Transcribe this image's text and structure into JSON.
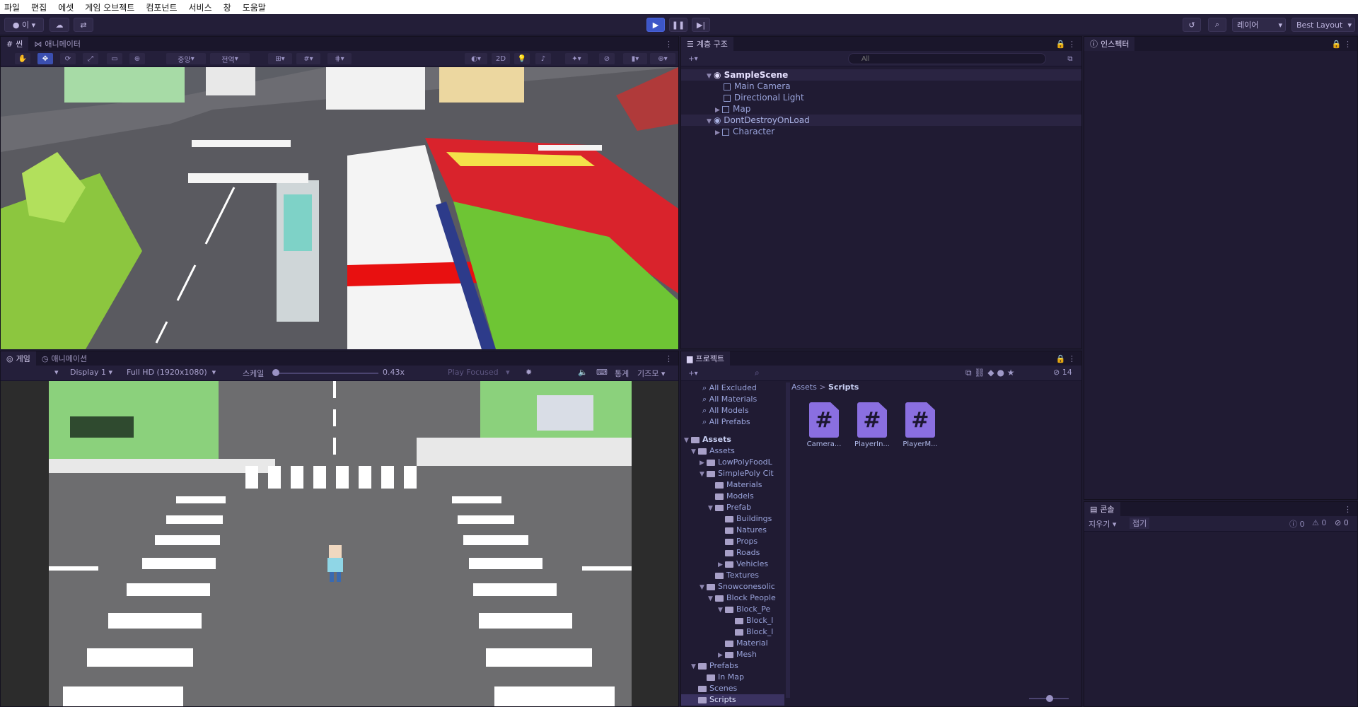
{
  "menu": [
    "파일",
    "편집",
    "에셋",
    "게임 오브젝트",
    "컴포넌트",
    "서비스",
    "창",
    "도움말"
  ],
  "toolbar": {
    "account_label": "이",
    "layers_label": "레이어",
    "layout_label": "Best Layout"
  },
  "scene_panel": {
    "tabs": [
      "씬",
      "애니메이터"
    ],
    "shading_label": "중앙",
    "global_label": "전역",
    "mode_2d": "2D"
  },
  "hierarchy": {
    "tab": "계층 구조",
    "search_placeholder": "All",
    "items": [
      {
        "label": "SampleScene",
        "type": "scene",
        "depth": 0
      },
      {
        "label": "Main Camera",
        "type": "object",
        "depth": 1
      },
      {
        "label": "Directional Light",
        "type": "object",
        "depth": 1
      },
      {
        "label": "Map",
        "type": "object",
        "depth": 1
      },
      {
        "label": "DontDestroyOnLoad",
        "type": "scene",
        "depth": 0
      },
      {
        "label": "Character",
        "type": "object",
        "depth": 1
      }
    ]
  },
  "inspector": {
    "tab": "인스펙터"
  },
  "game_panel": {
    "tabs": [
      "게임",
      "애니메이션"
    ],
    "display": "Display 1",
    "resolution": "Full HD (1920x1080)",
    "scale_label": "스케일",
    "scale_value": "0.43x",
    "play_mode": "Play Focused",
    "stats": "통계",
    "gizmos": "기즈모"
  },
  "project": {
    "tab": "프로젝트",
    "hidden_count": "14",
    "breadcrumb": [
      "Assets",
      "Scripts"
    ],
    "favorites": [
      "All Excluded",
      "All Materials",
      "All Models",
      "All Prefabs"
    ],
    "tree": [
      {
        "label": "Assets",
        "depth": 0,
        "bold": true
      },
      {
        "label": "Assets",
        "depth": 1
      },
      {
        "label": "LowPolyFoodL",
        "depth": 2
      },
      {
        "label": "SimplePoly Cit",
        "depth": 2
      },
      {
        "label": "Materials",
        "depth": 3
      },
      {
        "label": "Models",
        "depth": 3
      },
      {
        "label": "Prefab",
        "depth": 3
      },
      {
        "label": "Buildings",
        "depth": 4
      },
      {
        "label": "Natures",
        "depth": 4
      },
      {
        "label": "Props",
        "depth": 4
      },
      {
        "label": "Roads",
        "depth": 4
      },
      {
        "label": "Vehicles",
        "depth": 4
      },
      {
        "label": "Textures",
        "depth": 3
      },
      {
        "label": "Snowconesolic",
        "depth": 2
      },
      {
        "label": "Block People",
        "depth": 3
      },
      {
        "label": "Block_Pe",
        "depth": 4
      },
      {
        "label": "Block_l",
        "depth": 5
      },
      {
        "label": "Block_l",
        "depth": 5
      },
      {
        "label": "Material",
        "depth": 4
      },
      {
        "label": "Mesh",
        "depth": 4
      },
      {
        "label": "Prefabs",
        "depth": 1
      },
      {
        "label": "In Map",
        "depth": 2
      },
      {
        "label": "Scenes",
        "depth": 1
      },
      {
        "label": "Scripts",
        "depth": 1,
        "selected": true
      }
    ],
    "assets": [
      "Camera...",
      "PlayerIn...",
      "PlayerM..."
    ]
  },
  "console": {
    "tab": "콘솔",
    "clear": "지우기",
    "collapse": "접기",
    "counts": [
      "0",
      "0",
      "0"
    ]
  }
}
